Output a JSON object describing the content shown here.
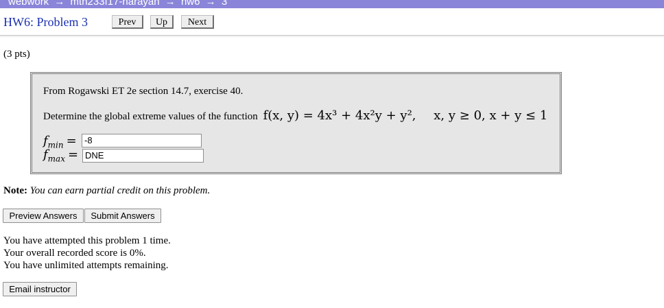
{
  "breadcrumb": {
    "items": [
      "webwork",
      "→",
      "mth233f17-narayan",
      "→",
      "hw6",
      "→",
      "3"
    ]
  },
  "header": {
    "title": "HW6: Problem 3",
    "nav": {
      "prev": "Prev",
      "up": "Up",
      "next": "Next"
    }
  },
  "problem": {
    "points": "(3 pts)",
    "source": "From Rogawski ET 2e section 14.7, exercise 40.",
    "question_text": "Determine the global extreme values of the function",
    "formula": "f(x, y) = 4x³ + 4x²y + y²,",
    "constraint": "x, y ≥ 0, x + y ≤ 1",
    "fmin_label": "f",
    "fmin_sub": "min",
    "fmax_label": "f",
    "fmax_sub": "max",
    "equals": "=",
    "fmin_value": "-8",
    "fmax_value": "DNE"
  },
  "note": {
    "label": "Note:",
    "text": "You can earn partial credit on this problem."
  },
  "actions": {
    "preview": "Preview Answers",
    "submit": "Submit Answers",
    "email": "Email instructor"
  },
  "status": {
    "attempted": "You have attempted this problem 1 time.",
    "score": "Your overall recorded score is 0%.",
    "remaining": "You have unlimited attempts remaining."
  },
  "colors": {
    "topbar": "#8a85d9",
    "title": "#1a2fb0",
    "problem_bg": "#e6e6e6"
  }
}
